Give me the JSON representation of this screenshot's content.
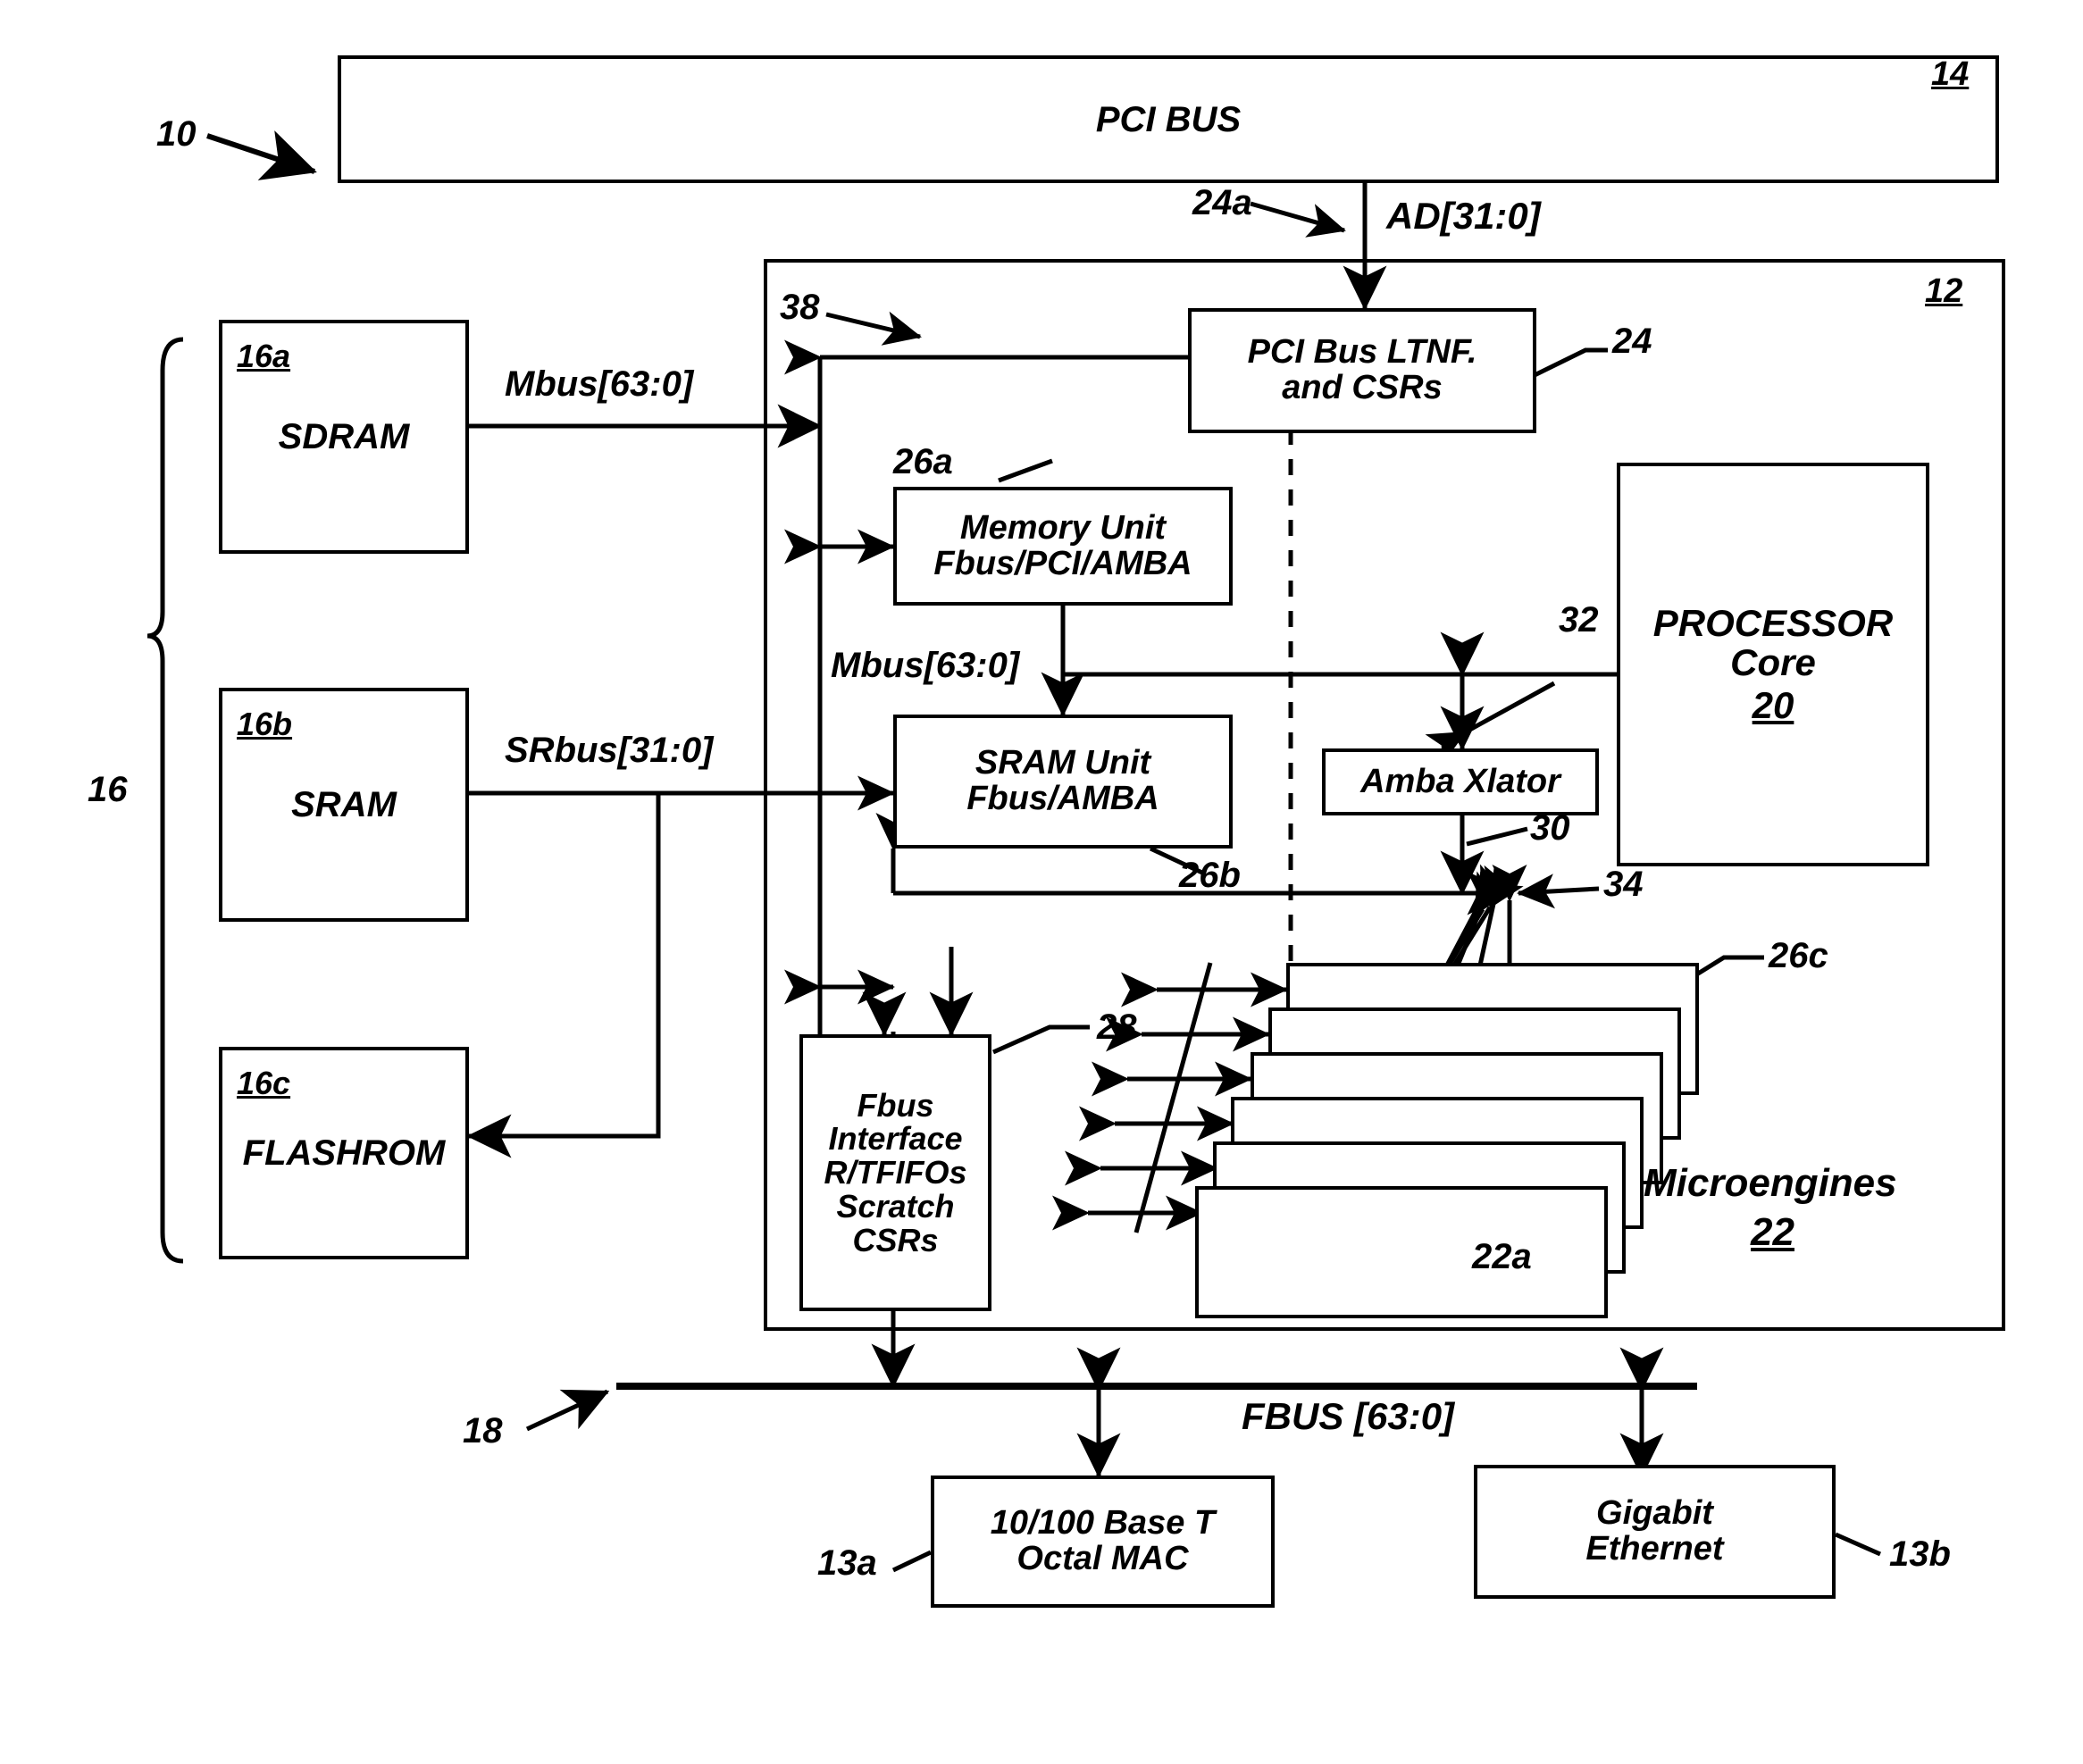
{
  "figure": {
    "kind": "patent-block-diagram",
    "root_ref": "10"
  },
  "blocks": {
    "pci_bus": {
      "label": "PCI BUS",
      "ref": "14"
    },
    "chip": {
      "label": "",
      "ref": "12"
    },
    "sdram": {
      "label": "SDRAM",
      "ref": "16a"
    },
    "sram": {
      "label": "SRAM",
      "ref": "16b"
    },
    "flashrom": {
      "label": "FLASHROM",
      "ref": "16c"
    },
    "memory_group": {
      "ref": "16"
    },
    "pci_iface": {
      "line1": "PCI Bus LTNF.",
      "line2": "and CSRs",
      "ref": "24"
    },
    "memory_unit": {
      "line1": "Memory Unit",
      "line2": "Fbus/PCI/AMBA",
      "ref": "26a"
    },
    "sram_unit": {
      "line1": "SRAM Unit",
      "line2": "Fbus/AMBA",
      "ref": "26b"
    },
    "amba_xlator": {
      "label": "Amba Xlator",
      "ref": "30"
    },
    "processor": {
      "line1": "PROCESSOR",
      "line2": "Core",
      "ref": "20"
    },
    "fbus_iface": {
      "line1": "Fbus",
      "line2": "Interface",
      "line3": "R/TFIFOs",
      "line4": "Scratch",
      "line5": "CSRs",
      "ref": "28"
    },
    "microengines": {
      "label": "Microengines",
      "ref": "22",
      "first_ref": "22a",
      "bus_ref": "26c"
    },
    "octal_mac": {
      "line1": "10/100 Base T",
      "line2": "Octal MAC",
      "ref": "13a"
    },
    "gigabit": {
      "line1": "Gigabit",
      "line2": "Ethernet",
      "ref": "13b"
    }
  },
  "bus_labels": {
    "ad": "AD[31:0]",
    "ad_ref": "24a",
    "mbus_left": "Mbus[63:0]",
    "mbus_mid": "Mbus[63:0]",
    "srbus": "SRbus[31:0]",
    "fbus": "FBUS [63:0]",
    "fbus_ref": "18",
    "internal_bus_ref": "38",
    "me_bus_ref": "34",
    "proc_bus_ref": "32"
  },
  "colors": {
    "ink": "#000000",
    "paper": "#ffffff"
  }
}
